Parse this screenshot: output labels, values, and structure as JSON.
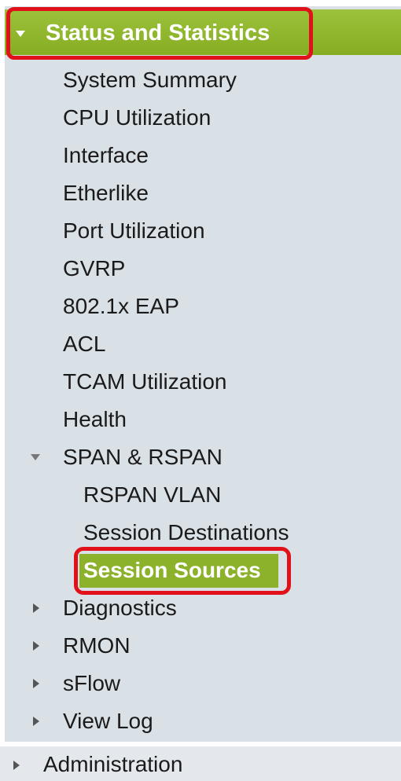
{
  "nav": {
    "section": {
      "label": "Status and Statistics",
      "state": "expanded",
      "highlighted": true
    },
    "items": [
      {
        "label": "System Summary"
      },
      {
        "label": "CPU Utilization"
      },
      {
        "label": "Interface"
      },
      {
        "label": "Etherlike"
      },
      {
        "label": "Port Utilization"
      },
      {
        "label": "GVRP"
      },
      {
        "label": "802.1x EAP"
      },
      {
        "label": "ACL"
      },
      {
        "label": "TCAM Utilization"
      },
      {
        "label": "Health"
      }
    ],
    "span": {
      "label": "SPAN & RSPAN",
      "state": "expanded",
      "children": [
        {
          "label": "RSPAN VLAN"
        },
        {
          "label": "Session Destinations"
        },
        {
          "label": "Session Sources",
          "selected": true
        }
      ]
    },
    "collapsed_items": [
      {
        "label": "Diagnostics"
      },
      {
        "label": "RMON"
      },
      {
        "label": "sFlow"
      },
      {
        "label": "View Log"
      }
    ],
    "administration": {
      "label": "Administration",
      "state": "collapsed"
    }
  },
  "colors": {
    "header_green": "#8fb82f",
    "selected_green": "#8cb22b",
    "panel_gray": "#d9e0e6",
    "highlight_red": "#e0111b"
  },
  "icons": {
    "expanded": "caret-down-icon",
    "collapsed": "caret-right-icon"
  }
}
